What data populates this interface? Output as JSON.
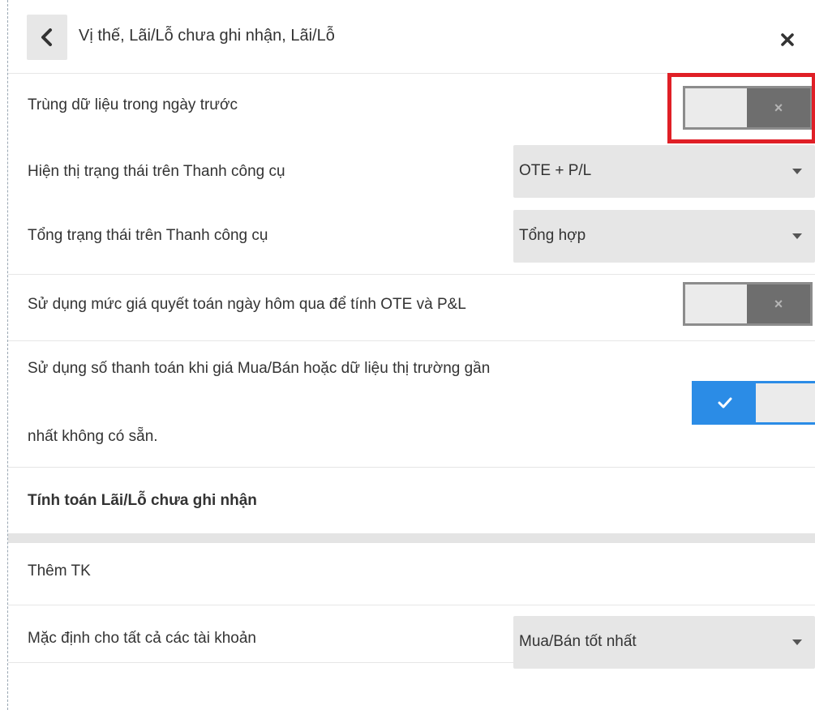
{
  "header": {
    "back_icon": "chevron-left-icon",
    "title": "Vị thế, Lãi/Lỗ chưa ghi nhận, Lãi/Lỗ",
    "close_icon": "close-icon"
  },
  "settings": {
    "duplicate_prev_day": {
      "label": "Trùng dữ liệu trong ngày trước",
      "state": "off",
      "off_glyph": "×"
    },
    "toolbar_status": {
      "label": "Hiện thị trạng thái trên Thanh công cụ",
      "value": "OTE + P/L"
    },
    "toolbar_total": {
      "label": "Tổng trạng thái trên Thanh công cụ",
      "value": "Tổng hợp"
    },
    "yesterday_settlement": {
      "label": "Sử dụng mức giá quyết toán ngày hôm qua để tính OTE và P&L",
      "state": "off",
      "off_glyph": "×"
    },
    "use_settlement": {
      "label_line1": "Sử dụng số thanh toán khi giá Mua/Bán hoặc dữ liệu thị trường gần",
      "label_line2": "nhất không có sẵn.",
      "state": "on",
      "on_icon": "check-icon"
    }
  },
  "unrealized_section": {
    "heading": "Tính toán Lãi/Lỗ chưa ghi nhận"
  },
  "accounts": {
    "add_account": "Thêm TK",
    "default_all": {
      "label": "Mặc định cho tất cả các tài khoản",
      "value": "Mua/Bán tốt nhất"
    }
  },
  "colors": {
    "highlight": "#e01f26",
    "toggle_on": "#2b8ce6",
    "toggle_off_dark": "#6e6e6e",
    "select_bg": "#e6e6e6"
  }
}
